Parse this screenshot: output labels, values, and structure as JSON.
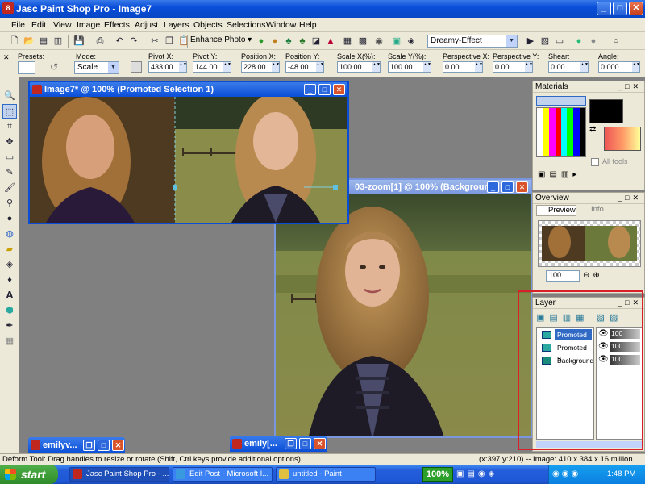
{
  "window": {
    "title": "Jasc Paint Shop Pro - Image7",
    "app_icon": "8"
  },
  "menus": [
    "File",
    "Edit",
    "View",
    "Image",
    "Effects",
    "Adjust",
    "Layers",
    "Objects",
    "Selections",
    "Window",
    "Help"
  ],
  "toolbar": {
    "enhance_label": "Enhance Photo ▾",
    "effect_value": "Dreamy-Effect"
  },
  "tool_options": {
    "presets_label": "Presets:",
    "mode_label": "Mode:",
    "mode_value": "Scale",
    "fields": [
      {
        "label": "Pivot X:",
        "value": "433.00"
      },
      {
        "label": "Pivot Y:",
        "value": "144.00"
      },
      {
        "label": "Position X:",
        "value": "228.00"
      },
      {
        "label": "Position Y:",
        "value": "-48.00"
      },
      {
        "label": "Scale X(%):",
        "value": "100.00"
      },
      {
        "label": "Scale Y(%):",
        "value": "100.00"
      },
      {
        "label": "Perspective X:",
        "value": "0.00"
      },
      {
        "label": "Perspective Y:",
        "value": "0.00"
      },
      {
        "label": "Shear:",
        "value": "0.00"
      },
      {
        "label": "Angle:",
        "value": "0.000"
      }
    ]
  },
  "documents": {
    "image7_title": "Image7* @ 100% (Promoted Selection 1)",
    "zoom_title": "03-zoom[1] @ 100% (Background)",
    "min1": "emilyv...",
    "min2": "emily[..."
  },
  "materials": {
    "title": "Materials",
    "all_tools": "All tools"
  },
  "overview": {
    "title": "Overview",
    "tab_preview": "Preview",
    "tab_info": "Info",
    "zoom": "100"
  },
  "layers": {
    "title": "Layer",
    "rows": [
      {
        "name": "Promoted S",
        "opacity": "100"
      },
      {
        "name": "Promoted S",
        "opacity": "100"
      },
      {
        "name": "Background",
        "opacity": "100"
      }
    ]
  },
  "status": {
    "left": "Deform Tool: Drag handles to resize or rotate (Shift, Ctrl keys provide additional options).",
    "right": "(x:397 y:210) -- Image:  410 x 384 x 16 million"
  },
  "taskbar": {
    "start": "start",
    "tasks": [
      "Jasc Paint Shop Pro - ...",
      "Edit Post - Microsoft I...",
      "untitled - Paint"
    ],
    "zoom": "100%",
    "clock": "1:48 PM"
  },
  "colors": {
    "titlebar": "#0a4ed8",
    "chrome": "#ece9d8",
    "workspace": "#808080",
    "highlight_box": "#d8202a"
  }
}
